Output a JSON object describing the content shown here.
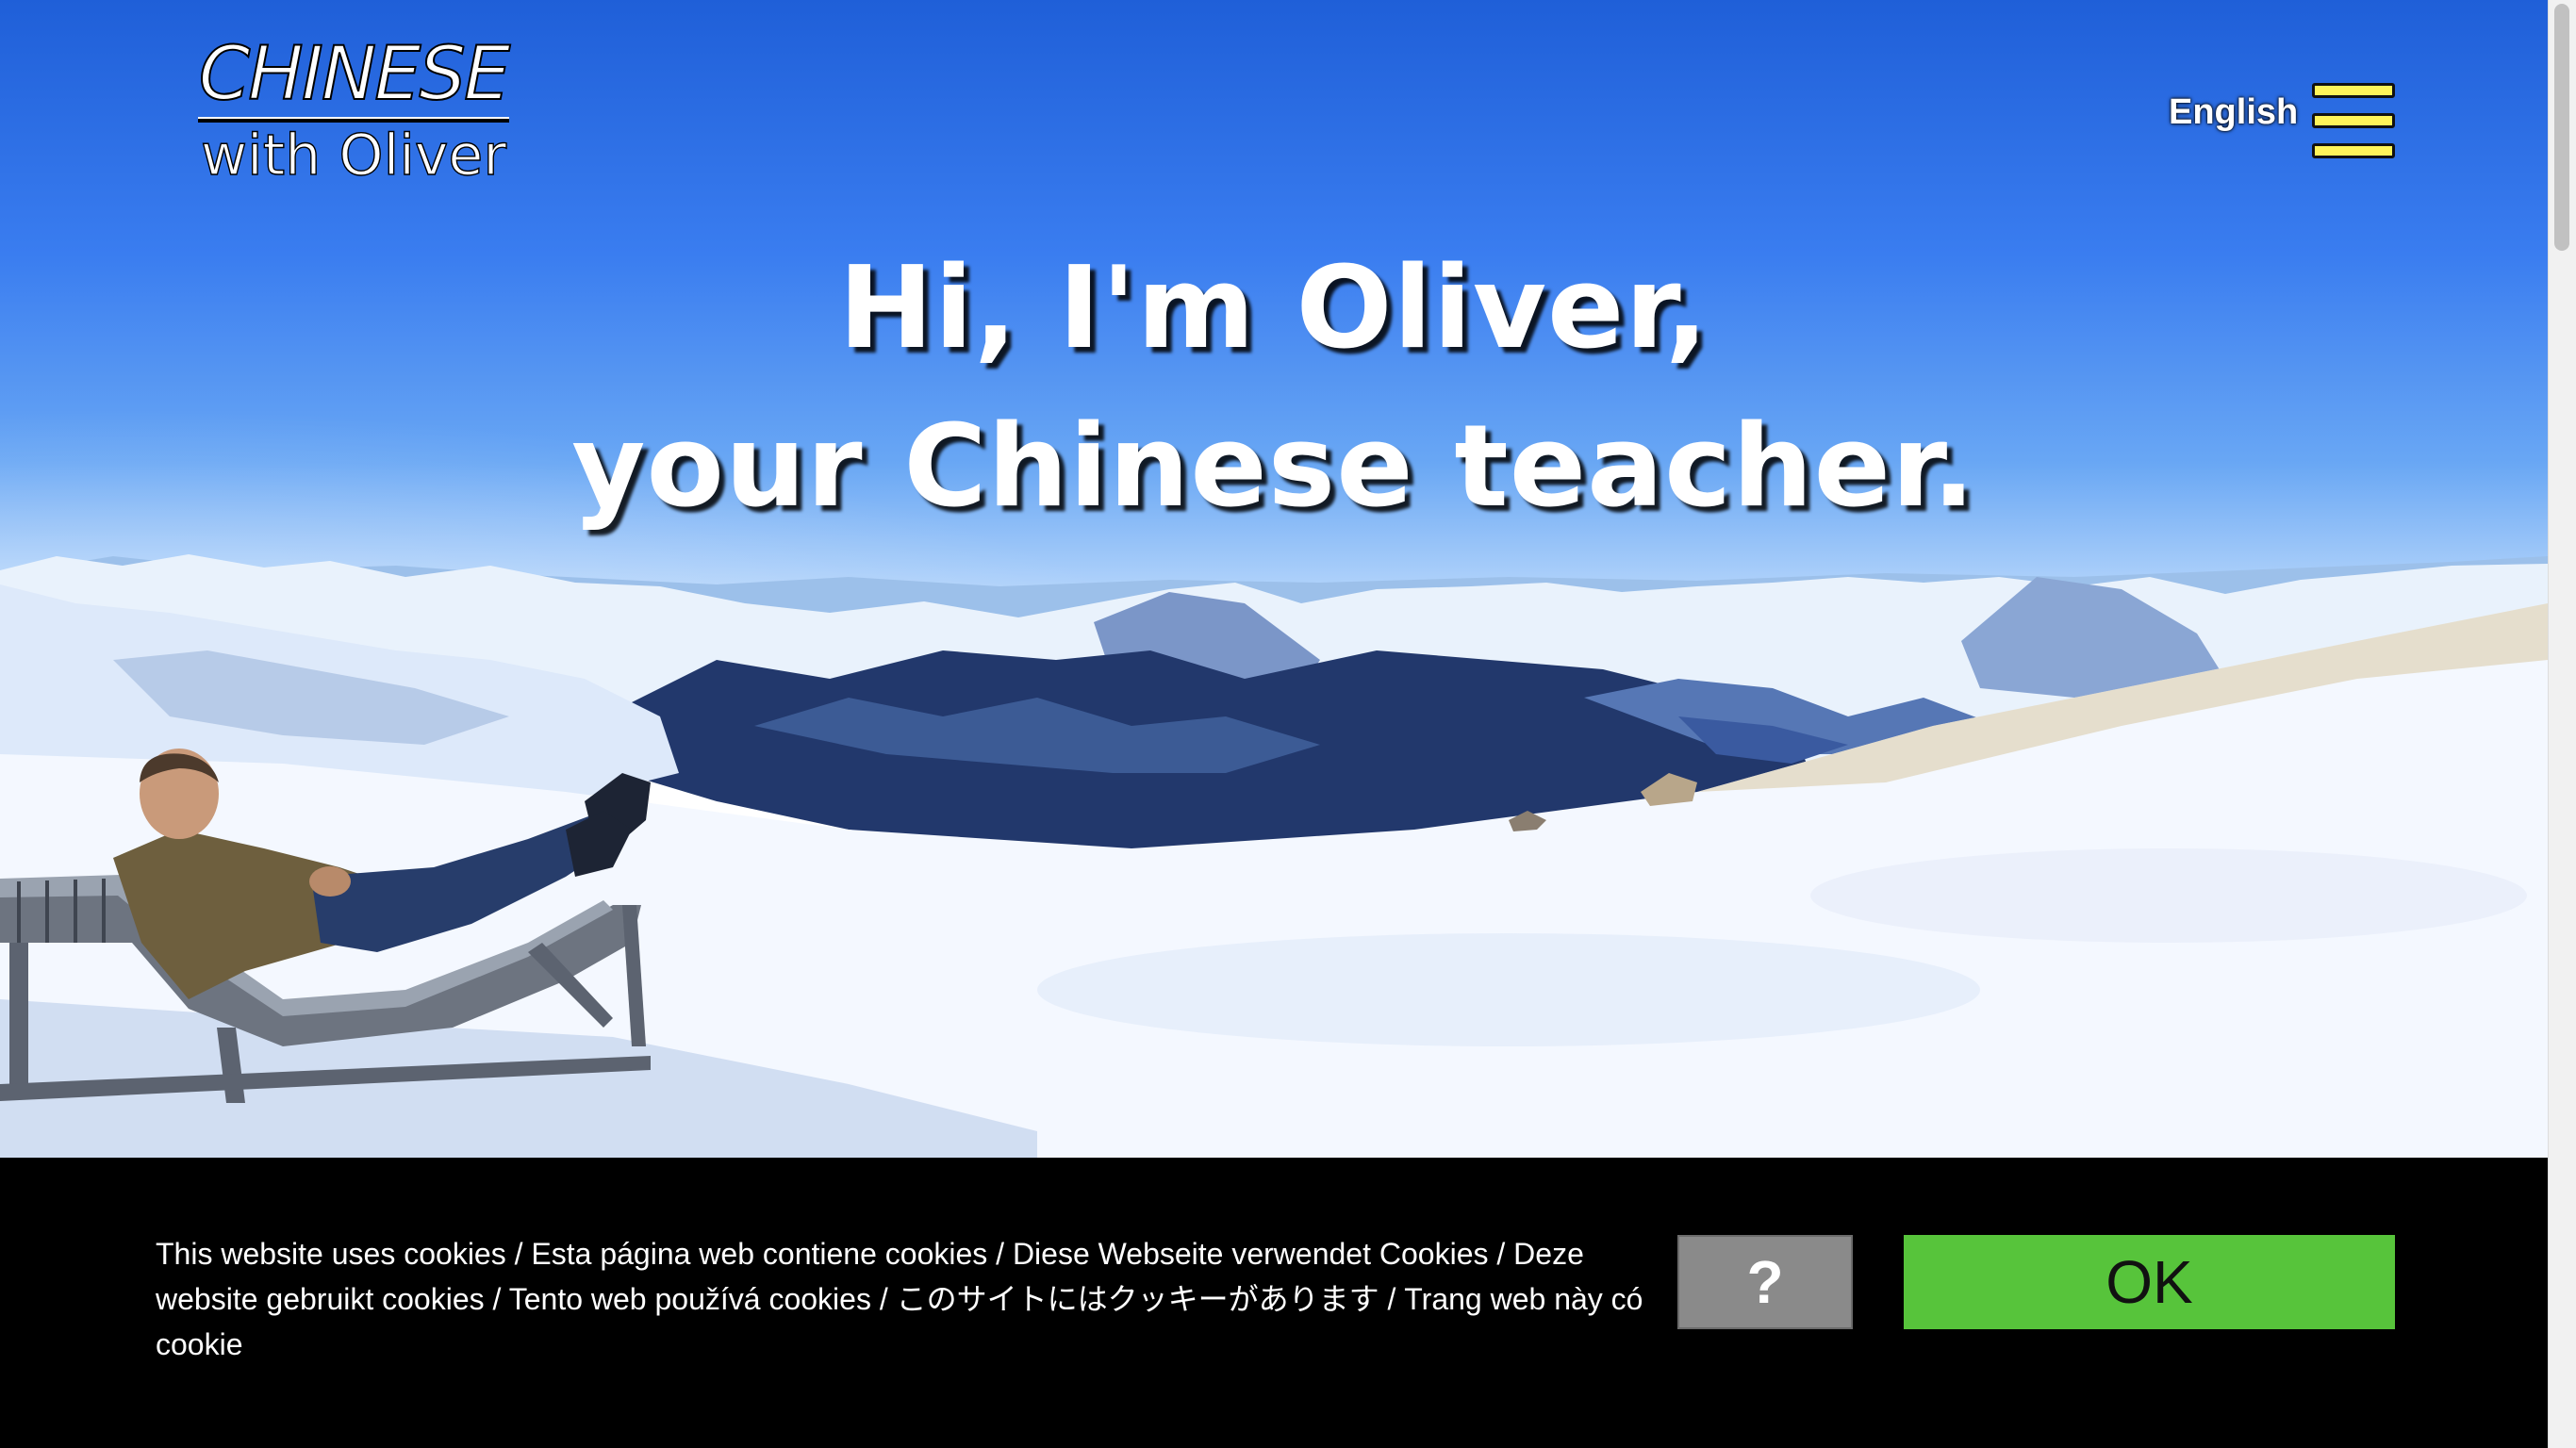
{
  "logo": {
    "top": "CHINESE",
    "bottom": "with Oliver"
  },
  "header": {
    "language": "English",
    "menu_icon": "hamburger-menu-icon",
    "menu_color": "#fff45a"
  },
  "hero": {
    "line1": "Hi, I'm Oliver,",
    "line2": "your Chinese teacher."
  },
  "cookie_banner": {
    "message": "This website uses cookies / Esta página web contiene cookies / Diese Webseite verwendet Cookies /  Deze website gebruikt cookies / Tento web používá cookies / このサイトにはクッキーがあります / Trang web này có cookie",
    "help_label": "?",
    "ok_label": "OK",
    "ok_color": "#57c43b",
    "help_color": "#8a8a8a"
  }
}
